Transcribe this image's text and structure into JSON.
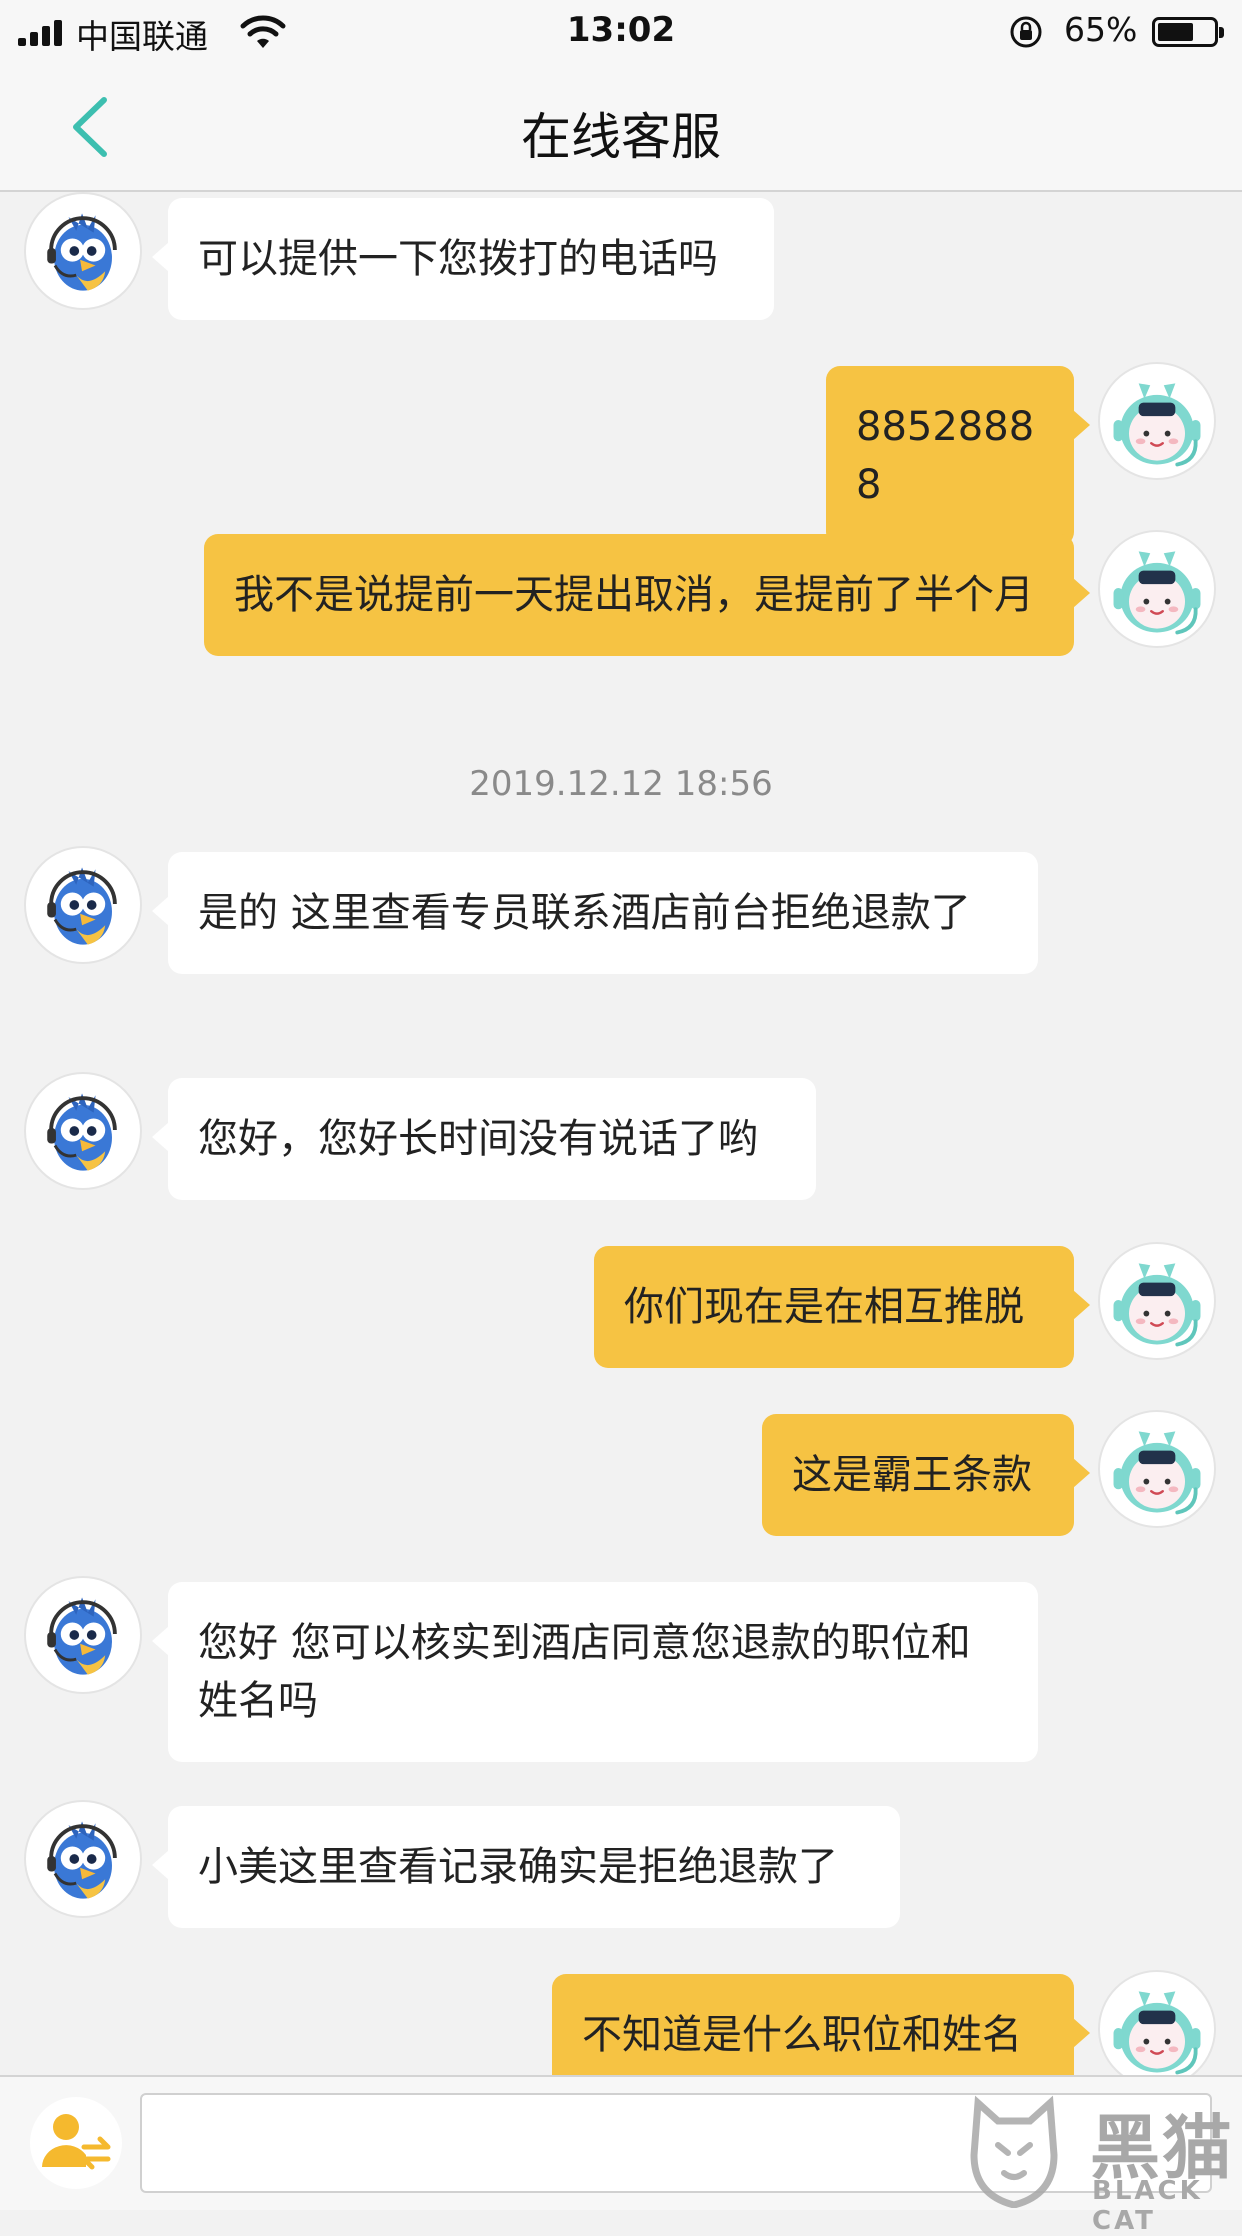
{
  "status_bar": {
    "carrier": "中国联通",
    "time": "13:02",
    "battery_percent": "65%",
    "battery_level": 0.65
  },
  "nav": {
    "title": "在线客服"
  },
  "messages": [
    {
      "sender": "agent",
      "text": "可以提供一下您拨打的电话吗"
    },
    {
      "sender": "user",
      "text": "88528888"
    },
    {
      "sender": "user",
      "text": "我不是说提前一天提出取消，是提前了半个月"
    },
    {
      "type": "timestamp",
      "text": "2019.12.12 18:56"
    },
    {
      "sender": "agent",
      "text": "是的 这里查看专员联系酒店前台拒绝退款了"
    },
    {
      "sender": "agent",
      "text": "您好，您好长时间没有说话了哟"
    },
    {
      "sender": "user",
      "text": "你们现在是在相互推脱"
    },
    {
      "sender": "user",
      "text": "这是霸王条款"
    },
    {
      "sender": "agent",
      "text": "您好 您可以核实到酒店同意您退款的职位和姓名吗"
    },
    {
      "sender": "agent",
      "text": "小美这里查看记录确实是拒绝退款了"
    },
    {
      "sender": "user",
      "text": "不知道是什么职位和姓名"
    }
  ],
  "input": {
    "value": "",
    "placeholder": ""
  },
  "watermark": {
    "title": "黑猫",
    "subtitle": "BLACK CAT"
  },
  "colors": {
    "accent": "#3dbfb0",
    "user_bubble": "#f6c343",
    "agent_bubble": "#ffffff",
    "background": "#f2f2f2"
  },
  "icons": {
    "back": "chevron-left-icon",
    "agent_avatar": "blue-bird-headset-avatar",
    "user_avatar": "teal-robot-avatar",
    "transfer": "transfer-to-human-icon"
  }
}
